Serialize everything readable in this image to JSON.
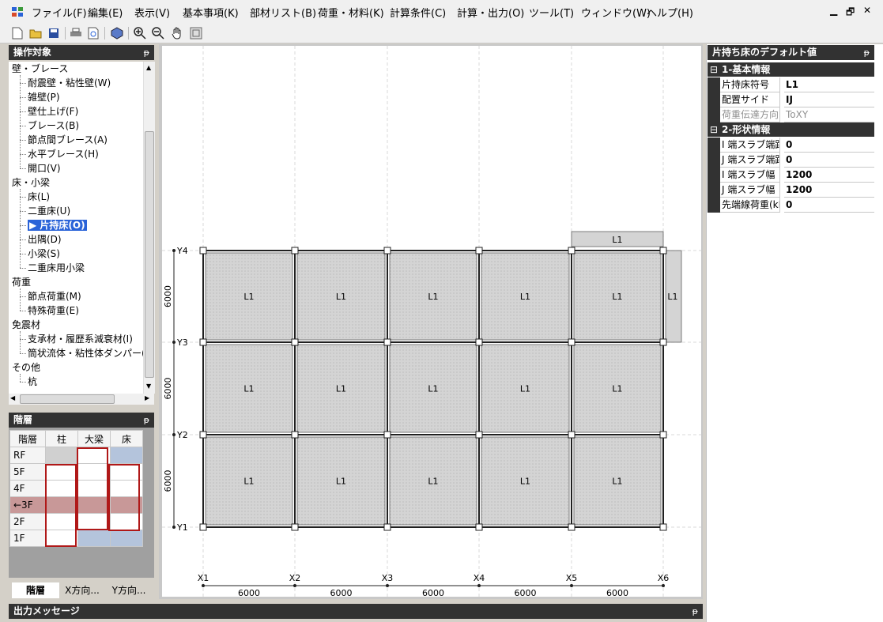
{
  "menu": [
    "ファイル(F)",
    "編集(E)",
    "表示(V)",
    "基本事項(K)",
    "部材リスト(B)",
    "荷重・材料(K)",
    "計算条件(C)",
    "計算・出力(O)",
    "ツール(T)",
    "ウィンドウ(W)",
    "ヘルプ(H)"
  ],
  "panels": {
    "target_title": "操作対象",
    "floor_title": "階層",
    "output_title": "出力メッセージ",
    "props_title": "片持ち床のデフォルト値"
  },
  "tree": [
    {
      "label": "壁・ブレース",
      "type": "cat"
    },
    {
      "label": "耐震壁・粘性壁(W)",
      "type": "leaf"
    },
    {
      "label": "雑壁(P)",
      "type": "leaf"
    },
    {
      "label": "壁仕上げ(F)",
      "type": "leaf"
    },
    {
      "label": "ブレース(B)",
      "type": "leaf"
    },
    {
      "label": "節点間ブレース(A)",
      "type": "leaf"
    },
    {
      "label": "水平ブレース(H)",
      "type": "leaf"
    },
    {
      "label": "開口(V)",
      "type": "leaf"
    },
    {
      "label": "床・小梁",
      "type": "cat"
    },
    {
      "label": "床(L)",
      "type": "leaf"
    },
    {
      "label": "二重床(U)",
      "type": "leaf"
    },
    {
      "label": "▶ 片持床(O)",
      "type": "leaf",
      "selected": true
    },
    {
      "label": "出隅(D)",
      "type": "leaf"
    },
    {
      "label": "小梁(S)",
      "type": "leaf"
    },
    {
      "label": "二重床用小梁",
      "type": "leaf"
    },
    {
      "label": "荷重",
      "type": "cat"
    },
    {
      "label": "節点荷重(M)",
      "type": "leaf"
    },
    {
      "label": "特殊荷重(E)",
      "type": "leaf"
    },
    {
      "label": "免震材",
      "type": "cat"
    },
    {
      "label": "支承材・履歴系減衰材(I)",
      "type": "leaf"
    },
    {
      "label": "筒状流体・粘性体ダンパー(R",
      "type": "leaf"
    },
    {
      "label": "その他",
      "type": "cat"
    },
    {
      "label": "杭",
      "type": "leaf"
    }
  ],
  "floor_table": {
    "headers": [
      "階層",
      "柱",
      "大梁",
      "床"
    ],
    "rows": [
      "RF",
      "5F",
      "4F",
      "←3F",
      "2F",
      "1F"
    ]
  },
  "tabs": [
    "階層",
    "X方向...",
    "Y方向..."
  ],
  "grid": {
    "x_labels": [
      "X1",
      "X2",
      "X3",
      "X4",
      "X5",
      "X6"
    ],
    "y_labels": [
      "Y1",
      "Y2",
      "Y3",
      "Y4"
    ],
    "x_spans": [
      "6000",
      "6000",
      "6000",
      "6000",
      "6000"
    ],
    "y_spans": [
      "6000",
      "6000",
      "6000"
    ],
    "slab_label": "L1"
  },
  "props": {
    "group1": "1-基本情報",
    "group2": "2-形状情報",
    "rows1": [
      {
        "key": "片持床符号",
        "value": "L1"
      },
      {
        "key": "配置サイド",
        "value": "IJ"
      },
      {
        "key": "荷重伝達方向",
        "value": "ToXY",
        "dim": true
      }
    ],
    "rows2": [
      {
        "key": "I 端スラブ端距離",
        "value": "0"
      },
      {
        "key": "J 端スラブ端距離",
        "value": "0"
      },
      {
        "key": "I 端スラブ幅",
        "value": "1200"
      },
      {
        "key": "J 端スラブ幅",
        "value": "1200"
      },
      {
        "key": "先端線荷重(kN/m)",
        "value": "0"
      }
    ]
  }
}
